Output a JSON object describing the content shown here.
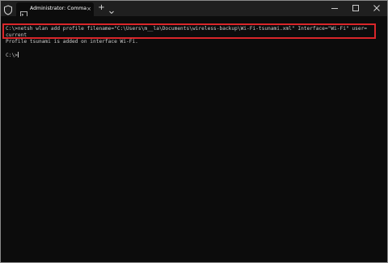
{
  "window": {
    "tab_title": "Administrator: Command Prom",
    "tab_close_glyph": "×",
    "new_tab_glyph": "+",
    "colors": {
      "background": "#0c0c0c",
      "titlebar": "#1f1f1f",
      "text": "#cccccc",
      "highlight_border": "#d9262a"
    }
  },
  "icons": {
    "shield": "shield-icon",
    "tab": "terminal-icon",
    "tab_close": "close-icon",
    "new_tab": "plus-icon",
    "dropdown": "chevron-down-icon",
    "minimize": "minimize-icon",
    "maximize": "maximize-icon",
    "close": "close-icon"
  },
  "terminal": {
    "lines": [
      "C:\\>netsh wlan add profile filename=\"C:\\Users\\m__la\\Documents\\wireless-backup\\Wi-Fi-tsunami.xml\" Interface=\"Wi-Fi\" user=",
      "current",
      "Profile tsunami is added on interface Wi-Fi.",
      "",
      "C:\\>"
    ]
  }
}
